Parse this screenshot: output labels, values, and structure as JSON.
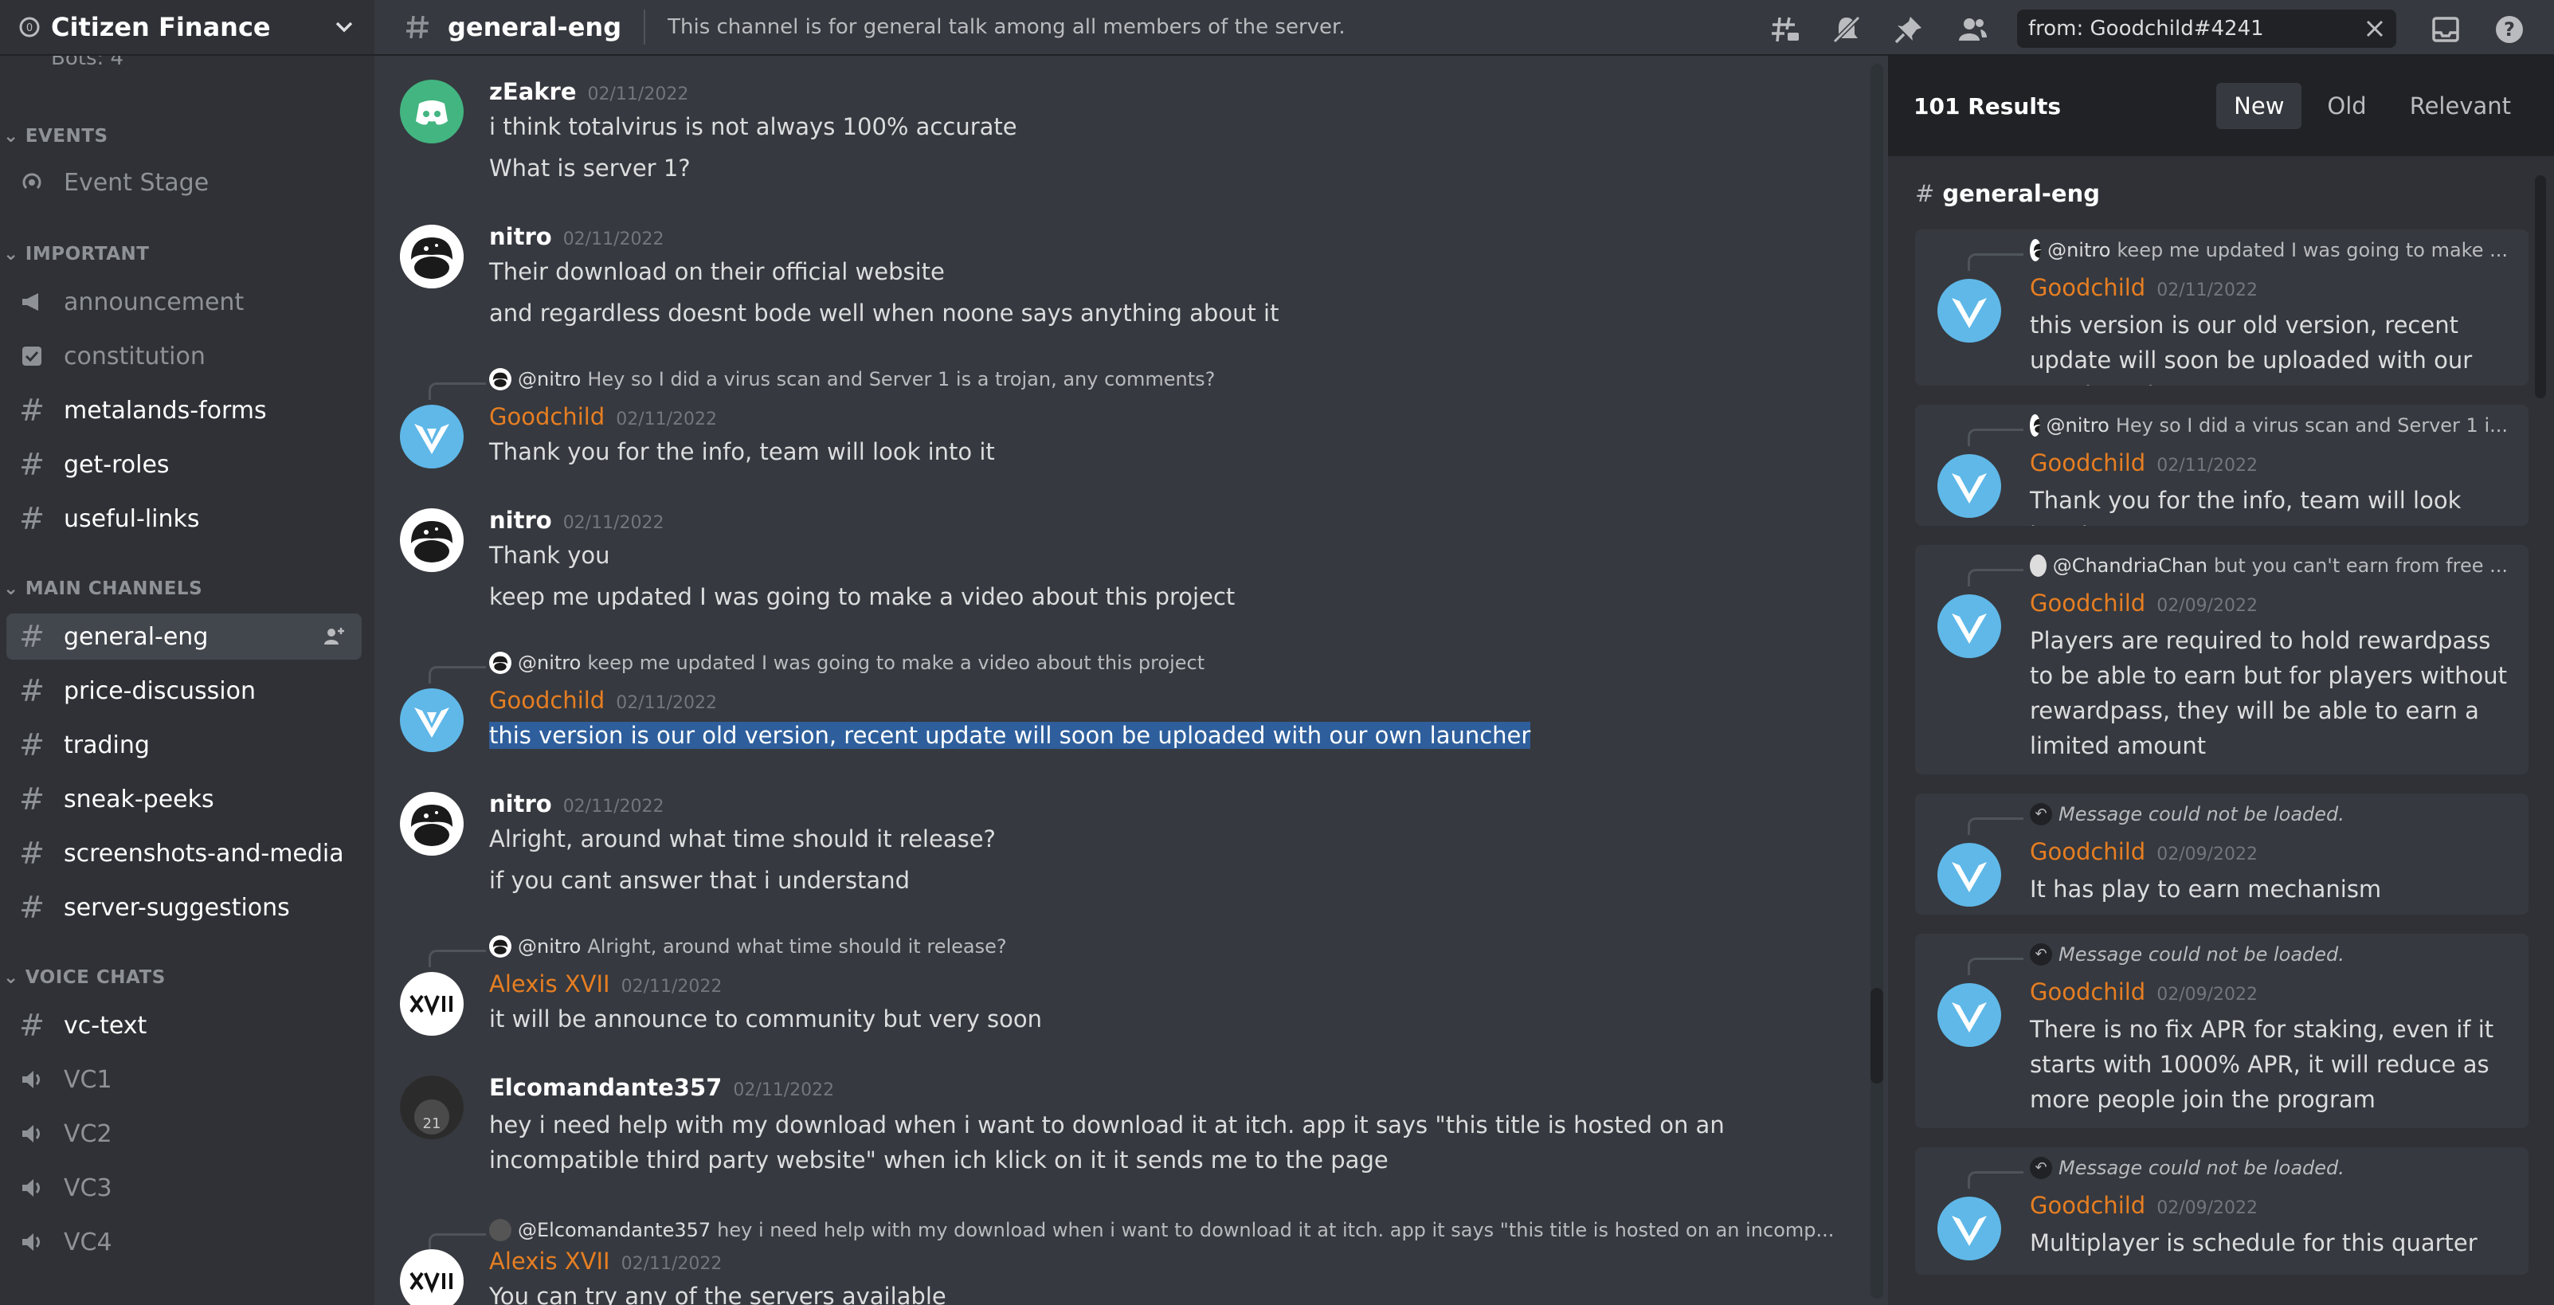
{
  "server": {
    "name": "Citizen Finance",
    "partial_top": "Bots: 4"
  },
  "sidebar": {
    "categories": {
      "events": "EVENTS",
      "important": "IMPORTANT",
      "main": "MAIN CHANNELS",
      "voice": "VOICE CHATS"
    },
    "channels": {
      "event_stage": "Event Stage",
      "announcement": "announcement",
      "constitution": "constitution",
      "metalands_forms": "metalands-forms",
      "get_roles": "get-roles",
      "useful_links": "useful-links",
      "general_eng": "general-eng",
      "price_discussion": "price-discussion",
      "trading": "trading",
      "sneak_peeks": "sneak-peeks",
      "screenshots_and_media": "screenshots-and-media",
      "server_suggestions": "server-suggestions",
      "vc_text": "vc-text",
      "vc1": "VC1",
      "vc2": "VC2",
      "vc3": "VC3",
      "vc4": "VC4"
    }
  },
  "topbar": {
    "channel": "general-eng",
    "topic": "This channel is for general talk among all members of the server.",
    "search_query": "from: Goodchild#4241"
  },
  "messages": {
    "m1": {
      "author": "zEakre",
      "time": "02/11/2022",
      "lines": [
        "i think totalvirus is not always 100% accurate",
        "What is server 1?"
      ]
    },
    "m2": {
      "author": "nitro",
      "time": "02/11/2022",
      "lines": [
        "Their download on their official website",
        "and regardless doesnt bode well when noone says anything about it"
      ]
    },
    "m3": {
      "reply_name": "@nitro",
      "reply_text": "Hey so I did a virus scan and Server 1 is a trojan, any comments?",
      "author": "Goodchild",
      "time": "02/11/2022",
      "text": "Thank you for the info, team will look into it"
    },
    "m4": {
      "author": "nitro",
      "time": "02/11/2022",
      "lines": [
        "Thank you",
        "keep me updated I was going to make a video about this project"
      ]
    },
    "m5": {
      "reply_name": "@nitro",
      "reply_text": "keep me updated I was going to make a video about this project",
      "author": "Goodchild",
      "time": "02/11/2022",
      "text": "this version is our old version, recent update will soon be uploaded with our own launcher"
    },
    "m6": {
      "author": "nitro",
      "time": "02/11/2022",
      "lines": [
        "Alright, around what time should it release?",
        "if you cant answer that i understand"
      ]
    },
    "m7": {
      "reply_name": "@nitro",
      "reply_text": "Alright, around what time should it release?",
      "author": "Alexis XVII",
      "time": "02/11/2022",
      "text": "it will be announce to community but very soon"
    },
    "m8": {
      "author": "Elcomandante357",
      "time": "02/11/2022",
      "text": "hey i need help with my download when i want to download it at itch. app it says \"this title is hosted on an incompatible third party website\" when ich klick on it it sends me to the page"
    },
    "m9": {
      "reply_name": "@Elcomandante357",
      "reply_text": "hey i need help with my download when i want to download it at itch. app it says \"this title is hosted on an incomp...",
      "author": "Alexis XVII",
      "time": "02/11/2022",
      "text": "You can try any of the servers available"
    }
  },
  "results": {
    "count": "101 Results",
    "sort": {
      "new": "New",
      "old": "Old",
      "relevant": "Relevant"
    },
    "channel": "general-eng",
    "items": [
      {
        "reply_name": "@nitro",
        "reply_text": "keep me updated I was going to make ...",
        "author": "Goodchild",
        "time": "02/11/2022",
        "text": "this version is our old version, recent update will soon be uploaded with our own launcher"
      },
      {
        "reply_name": "@nitro",
        "reply_text": "Hey so I did a virus scan and Server 1 i...",
        "author": "Goodchild",
        "time": "02/11/2022",
        "text": "Thank you for the info, team will look into it"
      },
      {
        "reply_name": "@ChandriaChan",
        "reply_text": "but you can't earn from free ...",
        "author": "Goodchild",
        "time": "02/09/2022",
        "text": "Players are required to hold rewardpass to be able to earn but for players without rewardpass, they will be able to earn a limited amount"
      },
      {
        "reply_text": "Message could not be loaded.",
        "author": "Goodchild",
        "time": "02/09/2022",
        "text": "It has play to earn mechanism"
      },
      {
        "reply_text": "Message could not be loaded.",
        "author": "Goodchild",
        "time": "02/09/2022",
        "text": "There is no fix APR for staking, even if it starts with 1000% APR, it will reduce as more people join the program"
      },
      {
        "reply_text": "Message could not be loaded.",
        "author": "Goodchild",
        "time": "02/09/2022",
        "text": "Multiplayer is schedule for this quarter"
      }
    ]
  },
  "colors": {
    "accent_orange": "#e67e22",
    "avatar_blue": "#5fb8e8",
    "avatar_green": "#43b581",
    "highlight": "#2e5f9c"
  }
}
